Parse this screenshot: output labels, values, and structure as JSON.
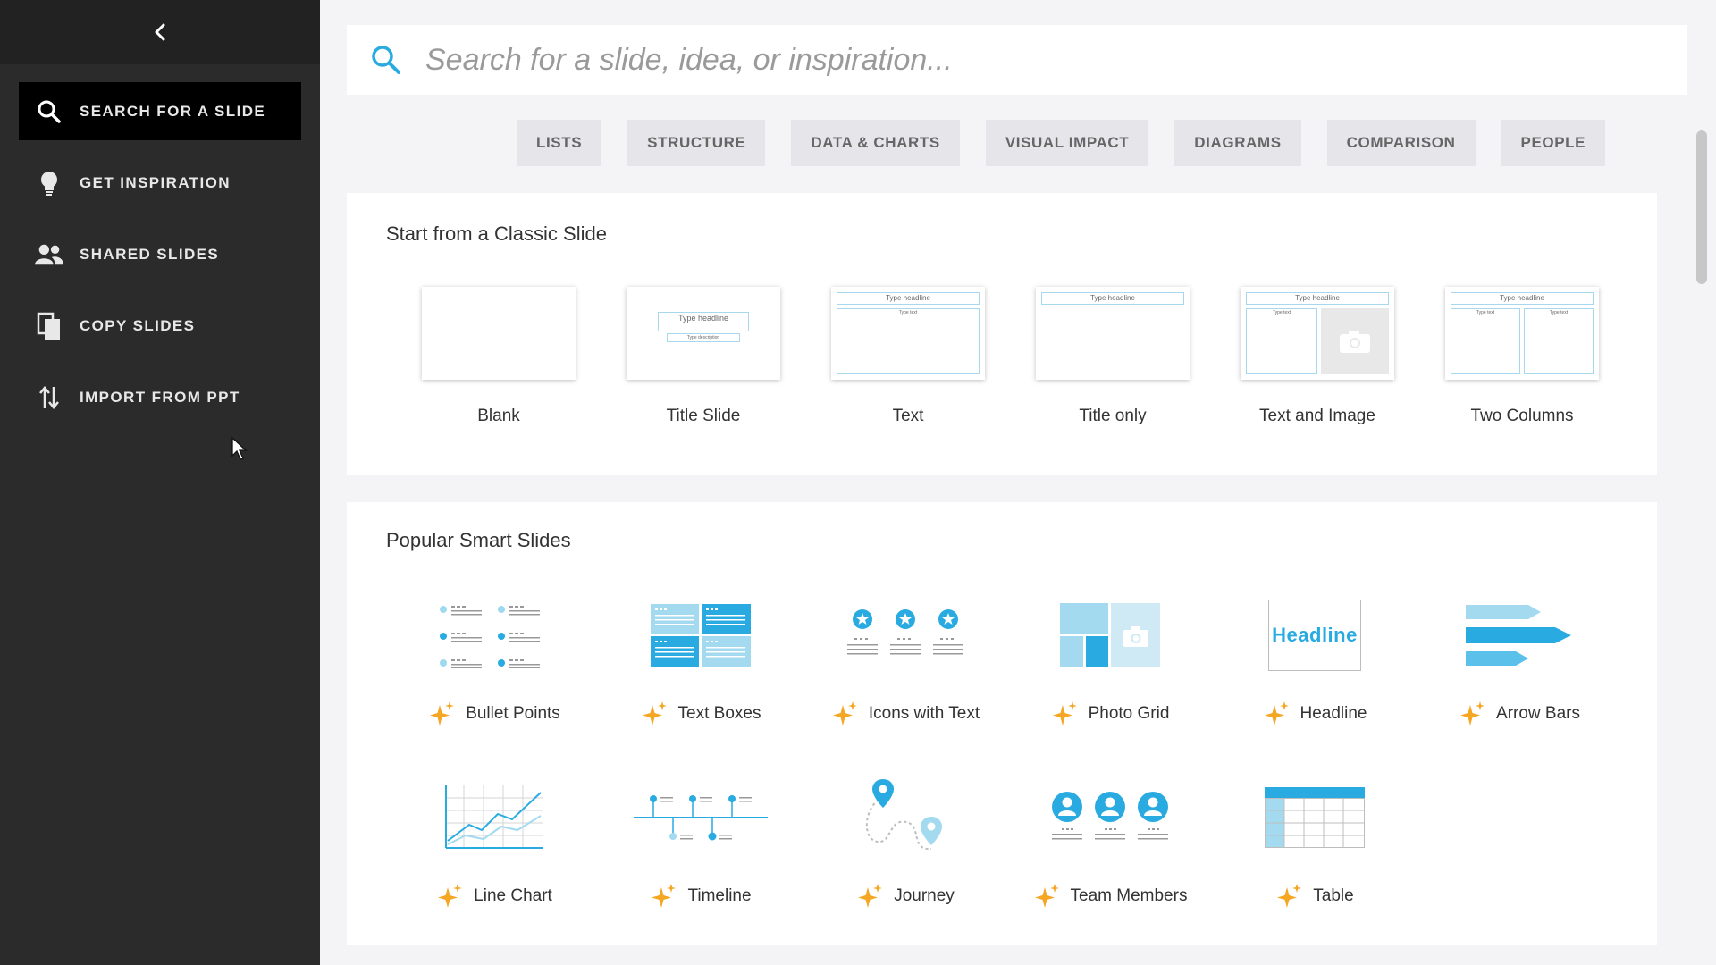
{
  "sidebar": {
    "items": [
      {
        "label": "SEARCH FOR A SLIDE",
        "icon": "search-icon"
      },
      {
        "label": "GET INSPIRATION",
        "icon": "lightbulb-icon"
      },
      {
        "label": "SHARED SLIDES",
        "icon": "people-icon"
      },
      {
        "label": "COPY SLIDES",
        "icon": "copy-icon"
      },
      {
        "label": "IMPORT FROM PPT",
        "icon": "import-icon"
      }
    ]
  },
  "search": {
    "placeholder": "Search for a slide, idea, or inspiration..."
  },
  "filters": [
    "LISTS",
    "STRUCTURE",
    "DATA & CHARTS",
    "VISUAL IMPACT",
    "DIAGRAMS",
    "COMPARISON",
    "PEOPLE"
  ],
  "classic": {
    "title": "Start from a Classic Slide",
    "items": [
      {
        "label": "Blank"
      },
      {
        "label": "Title Slide",
        "headline": "Type headline",
        "sub": "Type description"
      },
      {
        "label": "Text",
        "headline": "Type headline",
        "body": "Type text"
      },
      {
        "label": "Title only",
        "headline": "Type headline"
      },
      {
        "label": "Text and Image",
        "headline": "Type headline",
        "body": "Type text"
      },
      {
        "label": "Two Columns",
        "headline": "Type headline",
        "body": "Type text",
        "body2": "Type text"
      }
    ]
  },
  "smart": {
    "title": "Popular Smart Slides",
    "headline_thumb": "Headline",
    "items": [
      {
        "label": "Bullet Points"
      },
      {
        "label": "Text Boxes"
      },
      {
        "label": "Icons with Text"
      },
      {
        "label": "Photo Grid"
      },
      {
        "label": "Headline"
      },
      {
        "label": "Arrow Bars"
      },
      {
        "label": "Line Chart"
      },
      {
        "label": "Timeline"
      },
      {
        "label": "Journey"
      },
      {
        "label": "Team Members"
      },
      {
        "label": "Table"
      }
    ]
  },
  "colors": {
    "accent": "#29abe2",
    "accent_light": "#a3daf0",
    "sparkle": "#f5a623",
    "sidebar": "#2b2b2b"
  }
}
